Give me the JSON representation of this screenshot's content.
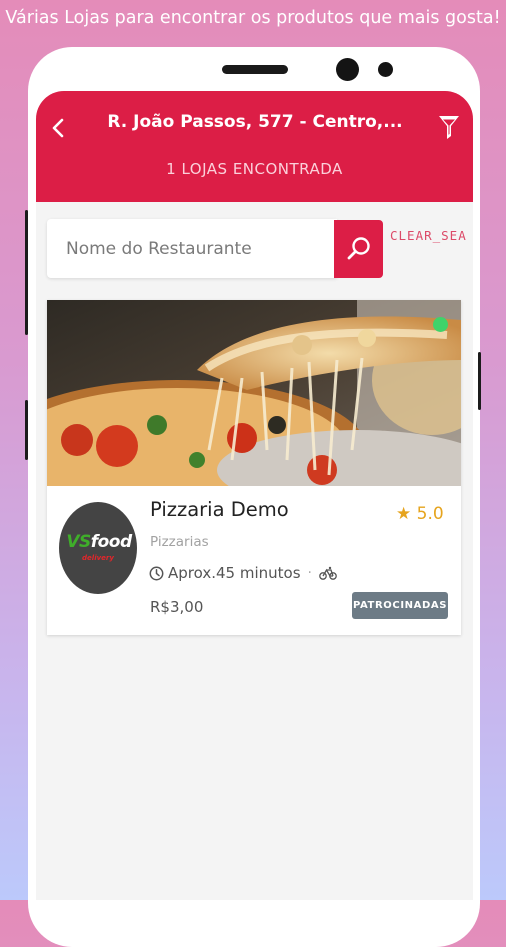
{
  "promo": {
    "text": "Várias Lojas para encontrar os produtos que mais gosta!"
  },
  "header": {
    "address": "R. João Passos, 577 - Centro,...",
    "stores_count": "1 LOJAS ENCONTRADA",
    "back_icon": "chevron-left-icon",
    "filter_icon": "filter-icon"
  },
  "search": {
    "placeholder": "Nome do Restaurante",
    "value": "",
    "clear_label": "CLEAR_SEA",
    "search_icon": "search-icon"
  },
  "stores": [
    {
      "name": "Pizzaria Demo",
      "rating": "5.0",
      "category": "Pizzarias",
      "delivery_time": "Aprox.45 minutos",
      "delivery_fee": "R$3,00",
      "badge": "PATROCINADAS",
      "logo": {
        "brand": "VSfood",
        "brand_highlight": "VS",
        "brand_rest": "food",
        "tagline": "delivery"
      },
      "status_open": true
    }
  ],
  "colors": {
    "primary": "#dc1e46",
    "rating_star": "#e6a41e",
    "open_status": "#3fd36a",
    "badge_bg": "#6d7b86"
  }
}
